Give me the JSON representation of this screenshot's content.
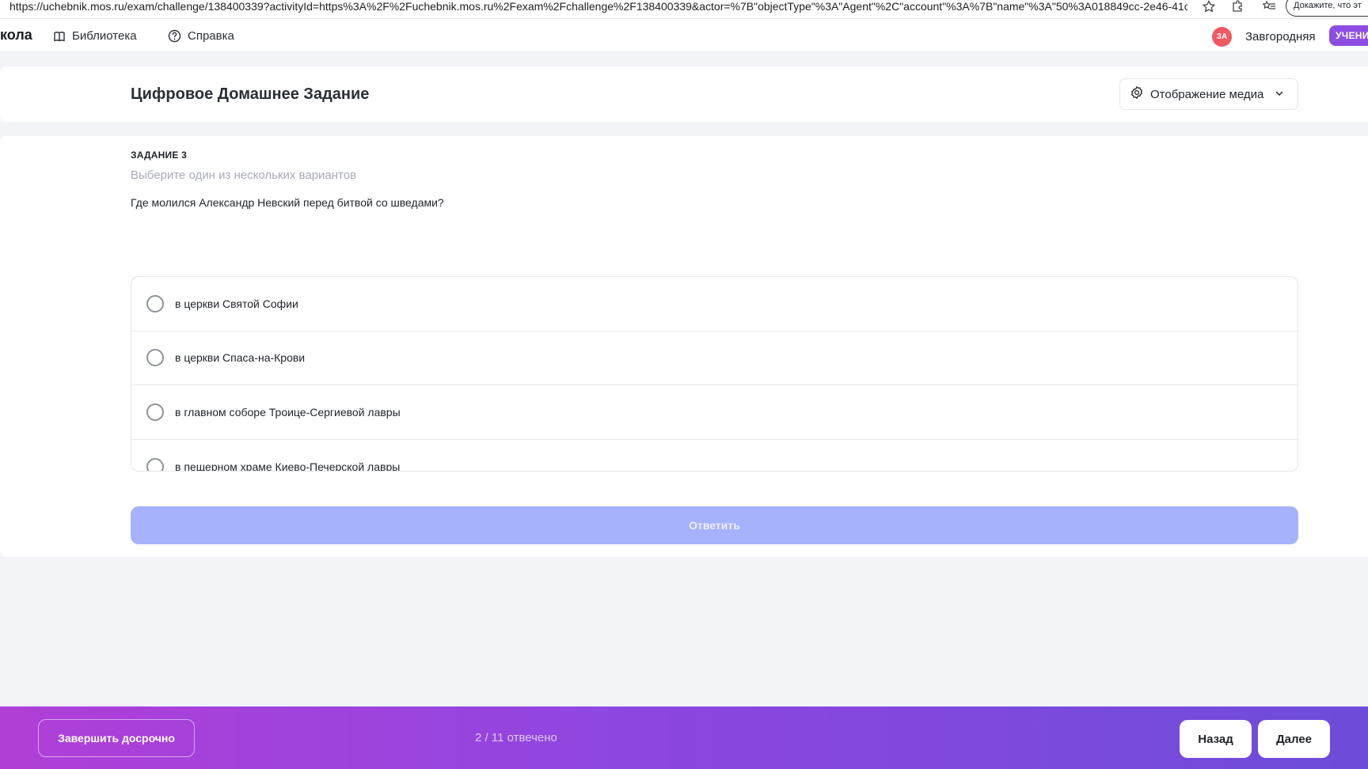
{
  "browser": {
    "url": "https://uchebnik.mos.ru/exam/challenge/138400339?activityId=https%3A%2F%2Fuchebnik.mos.ru%2Fexam%2Fchallenge%2F138400339&actor=%7B\"objectType\"%3A\"Agent\"%2C\"account\"%3A%7B\"name\"%3A\"50%3A018849cc-2e46-41cb-...",
    "prove_button": "Докажите, что эт"
  },
  "topnav": {
    "brand": "кола",
    "library": "Библиотека",
    "help": "Справка",
    "avatar_initials": "ЗА",
    "username": "Завгородняя",
    "role": "УЧЕНИ"
  },
  "header": {
    "title": "Цифровое Домашнее Задание",
    "media_button": "Отображение медиа"
  },
  "task": {
    "number": "ЗАДАНИЕ 3",
    "hint": "Выберите один из нескольких вариантов",
    "question": "Где молился Александр Невский перед битвой со шведами?",
    "options": [
      "в церкви Святой Софии",
      "в церкви Спаса-на-Крови",
      "в главном соборе Троице-Сергиевой лавры",
      "в пещерном храме Киево-Печерской лавры"
    ],
    "answer_button": "Ответить"
  },
  "footer": {
    "finish_button": "Завершить досрочно",
    "progress": "2 / 11 отвечено",
    "back_button": "Назад",
    "next_button": "Далее"
  },
  "colors": {
    "accent_disabled": "#a6b2fb",
    "footer_gradient_start": "#b03fd7",
    "footer_gradient_end": "#6d4cd9",
    "avatar": "#ef5a62",
    "role_badge": "#8d4fe3"
  }
}
